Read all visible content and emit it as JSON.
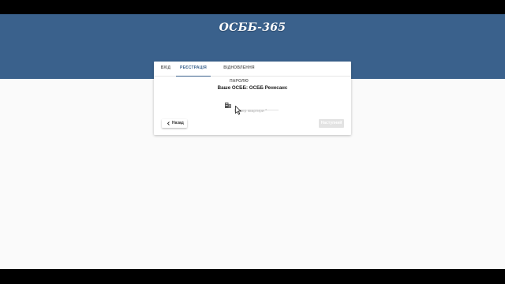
{
  "app": {
    "logo": "ОСББ-365"
  },
  "tabs": [
    {
      "label": "ВХІД",
      "active": false
    },
    {
      "label": "РЕЄСТРАЦІЯ",
      "active": true
    },
    {
      "label": "ВІДНОВЛЕННЯ ПАРОЛЮ",
      "active": false
    }
  ],
  "registration": {
    "heading": "Ваше ОСББ: ОСББ Ренесанс",
    "apartment_field": {
      "placeholder": "Номер квартири *",
      "value": "",
      "icon": "building-icon"
    },
    "back_button": {
      "label": "Назад",
      "icon": "chevron-left-icon"
    },
    "next_button": {
      "label": "Наступний",
      "enabled": false
    }
  },
  "colors": {
    "brand": "#3a618c",
    "background": "#fafafa"
  }
}
